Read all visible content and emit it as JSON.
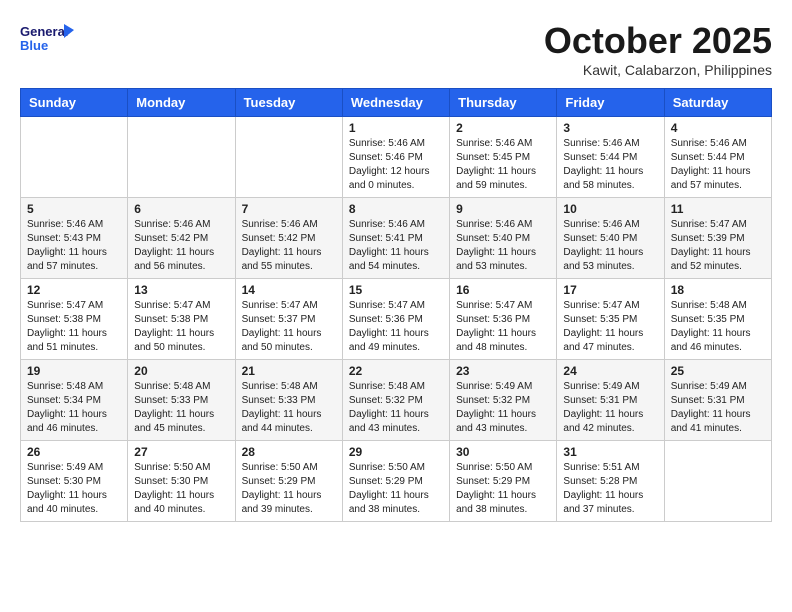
{
  "header": {
    "logo_line1": "General",
    "logo_line2": "Blue",
    "month": "October 2025",
    "location": "Kawit, Calabarzon, Philippines"
  },
  "weekdays": [
    "Sunday",
    "Monday",
    "Tuesday",
    "Wednesday",
    "Thursday",
    "Friday",
    "Saturday"
  ],
  "weeks": [
    [
      {
        "day": "",
        "info": ""
      },
      {
        "day": "",
        "info": ""
      },
      {
        "day": "",
        "info": ""
      },
      {
        "day": "1",
        "info": "Sunrise: 5:46 AM\nSunset: 5:46 PM\nDaylight: 12 hours\nand 0 minutes."
      },
      {
        "day": "2",
        "info": "Sunrise: 5:46 AM\nSunset: 5:45 PM\nDaylight: 11 hours\nand 59 minutes."
      },
      {
        "day": "3",
        "info": "Sunrise: 5:46 AM\nSunset: 5:44 PM\nDaylight: 11 hours\nand 58 minutes."
      },
      {
        "day": "4",
        "info": "Sunrise: 5:46 AM\nSunset: 5:44 PM\nDaylight: 11 hours\nand 57 minutes."
      }
    ],
    [
      {
        "day": "5",
        "info": "Sunrise: 5:46 AM\nSunset: 5:43 PM\nDaylight: 11 hours\nand 57 minutes."
      },
      {
        "day": "6",
        "info": "Sunrise: 5:46 AM\nSunset: 5:42 PM\nDaylight: 11 hours\nand 56 minutes."
      },
      {
        "day": "7",
        "info": "Sunrise: 5:46 AM\nSunset: 5:42 PM\nDaylight: 11 hours\nand 55 minutes."
      },
      {
        "day": "8",
        "info": "Sunrise: 5:46 AM\nSunset: 5:41 PM\nDaylight: 11 hours\nand 54 minutes."
      },
      {
        "day": "9",
        "info": "Sunrise: 5:46 AM\nSunset: 5:40 PM\nDaylight: 11 hours\nand 53 minutes."
      },
      {
        "day": "10",
        "info": "Sunrise: 5:46 AM\nSunset: 5:40 PM\nDaylight: 11 hours\nand 53 minutes."
      },
      {
        "day": "11",
        "info": "Sunrise: 5:47 AM\nSunset: 5:39 PM\nDaylight: 11 hours\nand 52 minutes."
      }
    ],
    [
      {
        "day": "12",
        "info": "Sunrise: 5:47 AM\nSunset: 5:38 PM\nDaylight: 11 hours\nand 51 minutes."
      },
      {
        "day": "13",
        "info": "Sunrise: 5:47 AM\nSunset: 5:38 PM\nDaylight: 11 hours\nand 50 minutes."
      },
      {
        "day": "14",
        "info": "Sunrise: 5:47 AM\nSunset: 5:37 PM\nDaylight: 11 hours\nand 50 minutes."
      },
      {
        "day": "15",
        "info": "Sunrise: 5:47 AM\nSunset: 5:36 PM\nDaylight: 11 hours\nand 49 minutes."
      },
      {
        "day": "16",
        "info": "Sunrise: 5:47 AM\nSunset: 5:36 PM\nDaylight: 11 hours\nand 48 minutes."
      },
      {
        "day": "17",
        "info": "Sunrise: 5:47 AM\nSunset: 5:35 PM\nDaylight: 11 hours\nand 47 minutes."
      },
      {
        "day": "18",
        "info": "Sunrise: 5:48 AM\nSunset: 5:35 PM\nDaylight: 11 hours\nand 46 minutes."
      }
    ],
    [
      {
        "day": "19",
        "info": "Sunrise: 5:48 AM\nSunset: 5:34 PM\nDaylight: 11 hours\nand 46 minutes."
      },
      {
        "day": "20",
        "info": "Sunrise: 5:48 AM\nSunset: 5:33 PM\nDaylight: 11 hours\nand 45 minutes."
      },
      {
        "day": "21",
        "info": "Sunrise: 5:48 AM\nSunset: 5:33 PM\nDaylight: 11 hours\nand 44 minutes."
      },
      {
        "day": "22",
        "info": "Sunrise: 5:48 AM\nSunset: 5:32 PM\nDaylight: 11 hours\nand 43 minutes."
      },
      {
        "day": "23",
        "info": "Sunrise: 5:49 AM\nSunset: 5:32 PM\nDaylight: 11 hours\nand 43 minutes."
      },
      {
        "day": "24",
        "info": "Sunrise: 5:49 AM\nSunset: 5:31 PM\nDaylight: 11 hours\nand 42 minutes."
      },
      {
        "day": "25",
        "info": "Sunrise: 5:49 AM\nSunset: 5:31 PM\nDaylight: 11 hours\nand 41 minutes."
      }
    ],
    [
      {
        "day": "26",
        "info": "Sunrise: 5:49 AM\nSunset: 5:30 PM\nDaylight: 11 hours\nand 40 minutes."
      },
      {
        "day": "27",
        "info": "Sunrise: 5:50 AM\nSunset: 5:30 PM\nDaylight: 11 hours\nand 40 minutes."
      },
      {
        "day": "28",
        "info": "Sunrise: 5:50 AM\nSunset: 5:29 PM\nDaylight: 11 hours\nand 39 minutes."
      },
      {
        "day": "29",
        "info": "Sunrise: 5:50 AM\nSunset: 5:29 PM\nDaylight: 11 hours\nand 38 minutes."
      },
      {
        "day": "30",
        "info": "Sunrise: 5:50 AM\nSunset: 5:29 PM\nDaylight: 11 hours\nand 38 minutes."
      },
      {
        "day": "31",
        "info": "Sunrise: 5:51 AM\nSunset: 5:28 PM\nDaylight: 11 hours\nand 37 minutes."
      },
      {
        "day": "",
        "info": ""
      }
    ]
  ]
}
